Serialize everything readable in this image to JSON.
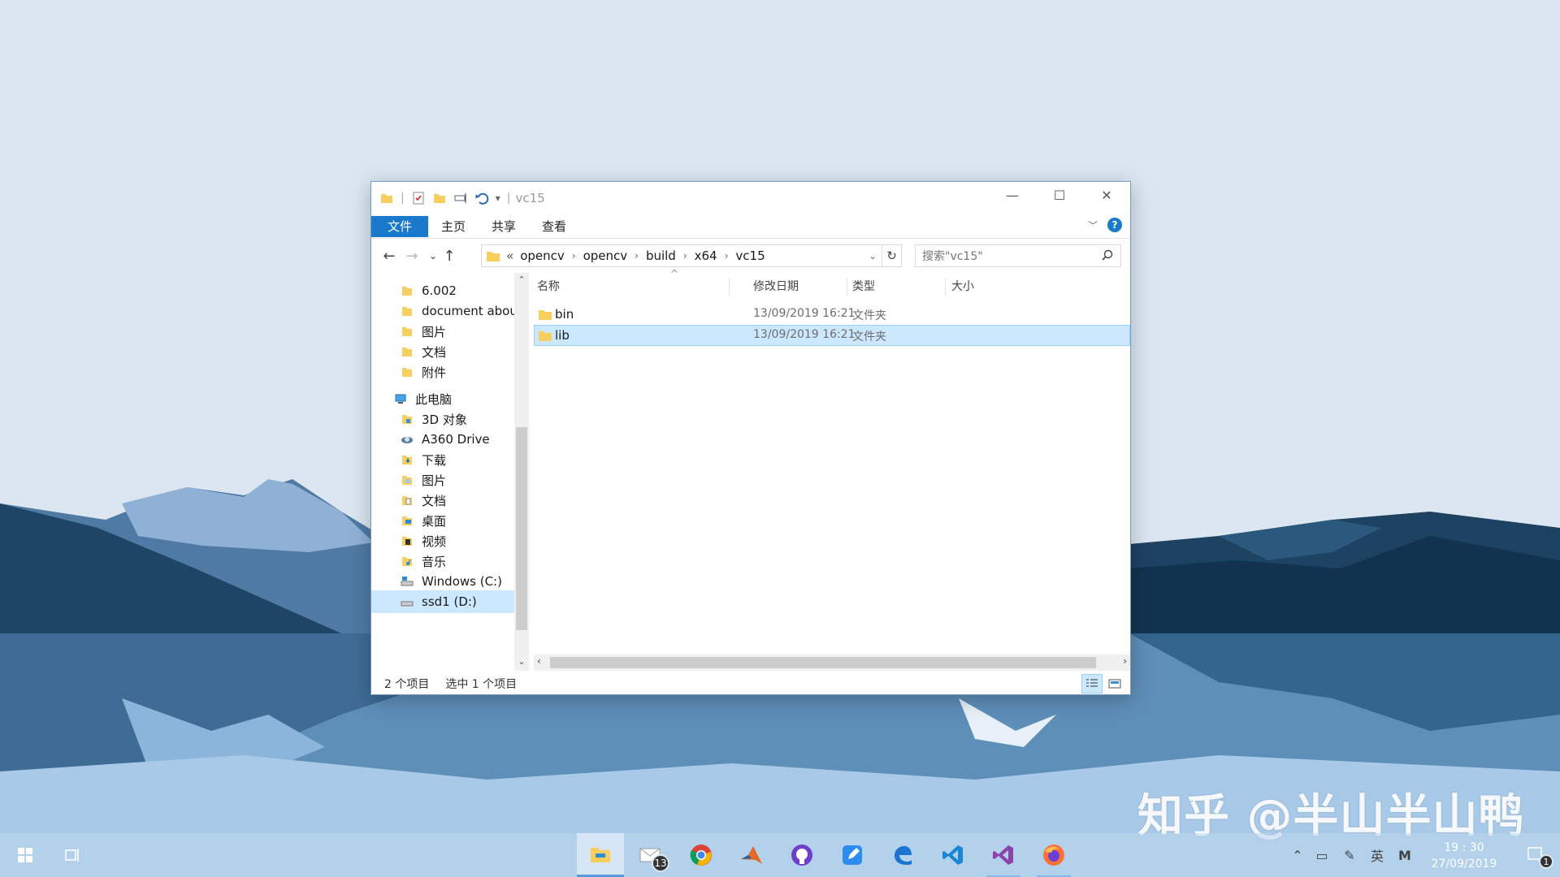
{
  "window": {
    "title": "vc15",
    "ribbon_tabs": [
      "文件",
      "主页",
      "共享",
      "查看"
    ],
    "help": "?"
  },
  "address": {
    "overflow": "«",
    "crumbs": [
      "opencv",
      "opencv",
      "build",
      "x64",
      "vc15"
    ]
  },
  "search": {
    "placeholder": "搜索\"vc15\""
  },
  "nav_pane": {
    "items": [
      {
        "label": "6.002",
        "icon": "folder-icon"
      },
      {
        "label": "document abou",
        "icon": "folder-icon"
      },
      {
        "label": "图片",
        "icon": "folder-icon"
      },
      {
        "label": "文档",
        "icon": "folder-icon"
      },
      {
        "label": "附件",
        "icon": "folder-icon"
      },
      {
        "label": "此电脑",
        "icon": "this-pc-icon"
      },
      {
        "label": "3D 对象",
        "icon": "3d-objects-icon"
      },
      {
        "label": "A360 Drive",
        "icon": "a360-drive-icon"
      },
      {
        "label": "下载",
        "icon": "downloads-icon"
      },
      {
        "label": "图片",
        "icon": "pictures-icon"
      },
      {
        "label": "文档",
        "icon": "documents-icon"
      },
      {
        "label": "桌面",
        "icon": "desktop-icon"
      },
      {
        "label": "视频",
        "icon": "videos-icon"
      },
      {
        "label": "音乐",
        "icon": "music-icon"
      },
      {
        "label": "Windows (C:)",
        "icon": "drive-c-icon"
      },
      {
        "label": "ssd1 (D:)",
        "icon": "drive-d-icon"
      }
    ]
  },
  "columns": [
    "名称",
    "修改日期",
    "类型",
    "大小"
  ],
  "files": [
    {
      "name": "bin",
      "modified": "13/09/2019 16:21",
      "type": "文件夹",
      "size": ""
    },
    {
      "name": "lib",
      "modified": "13/09/2019 16:21",
      "type": "文件夹",
      "size": ""
    }
  ],
  "selected_file": "lib",
  "status": {
    "count": "2 个项目",
    "selection": "选中 1 个项目"
  },
  "watermark": "知乎 @半山半山鸭",
  "taskbar": {
    "apps": [
      {
        "name": "file-explorer-icon"
      },
      {
        "name": "mail-icon",
        "badge": "13"
      },
      {
        "name": "chrome-icon"
      },
      {
        "name": "matlab-icon"
      },
      {
        "name": "github-icon"
      },
      {
        "name": "notes-icon"
      },
      {
        "name": "edge-icon"
      },
      {
        "name": "vscode-icon"
      },
      {
        "name": "visual-studio-icon"
      },
      {
        "name": "firefox-icon"
      }
    ],
    "ime": "英",
    "ime_mode": "M",
    "time": "19 : 30",
    "date": "27/09/2019",
    "notifications": "1"
  },
  "colors": {
    "accent": "#1979ca",
    "selection": "#cce8ff",
    "folder": "#f8cf5f"
  }
}
